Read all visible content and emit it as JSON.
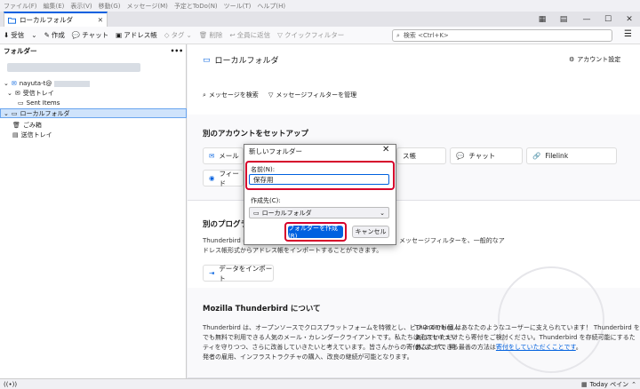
{
  "menubar": [
    "ファイル(F)",
    "編集(E)",
    "表示(V)",
    "移動(G)",
    "メッセージ(M)",
    "予定とToDo(N)",
    "ツール(T)",
    "ヘルプ(H)"
  ],
  "tab": {
    "label": "ローカルフォルダ"
  },
  "toolbar": {
    "get_mail": "受信",
    "write": "作成",
    "chat": "チャット",
    "address_book": "アドレス帳",
    "tag": "タグ",
    "delete": "削除",
    "reply_all": "全員に返信",
    "quick_filter": "クイックフィルター"
  },
  "search": {
    "placeholder": "検索 <Ctrl+K>"
  },
  "folder_pane": {
    "header": "フォルダー",
    "more": "•••",
    "account": "nayuta-t@",
    "inbox": "受信トレイ",
    "sent": "Sent Items",
    "local": "ローカルフォルダ",
    "trash": "ごみ箱",
    "outbox": "送信トレイ"
  },
  "main": {
    "title": "ローカルフォルダ",
    "account_settings": "アカウント設定",
    "search_messages": "メッセージを検索",
    "manage_filters": "メッセージフィルターを管理",
    "setup_heading": "別のアカウントをセットアップ",
    "cards": {
      "mail": "メール",
      "address": "ス帳",
      "chat": "チャット",
      "filelink": "Filelink",
      "feed": "フィード"
    },
    "import_heading": "別のプログラム",
    "import_text_1": "Thunderbird に",
    "import_text_1b": "メッセージフィルターを、一般的なア",
    "import_text_2": "ドレス帳形式からアドレス帳をインポートすることができます。",
    "import_button": "データをインポート",
    "about_heading": "Mozilla Thunderbird について",
    "about_text_1": "Thunderbird は、オープンソースでクロスプラットフォームを特徴とし、ビジネスでも個人",
    "about_text_2": "でも無料で利用できる人気のメール・カレンダークライアントです。私たちはそのセキュリ",
    "about_text_3": "ティを守りつつ、さらに改善していきたいと考えています。皆さんからの寄付によって、開",
    "about_text_4": "発者の雇用、インフラストラクチャの購入、改良の継続が可能となります。",
    "donate_text_1": "Thunderbird はあなたのようなユーザーに支えられています！ Thunderbird を気に",
    "donate_text_2": "入っていただけたら寄付をご検討ください。Thunderbird を存続可能にするため、",
    "donate_text_3": "あなたができる最善の方法は",
    "donate_link": "寄付をしていただくことです",
    "donate_text_4": "。"
  },
  "dialog": {
    "title": "新しいフォルダー",
    "name_label": "名前(N):",
    "name_value": "保存用",
    "create_in_label": "作成先(C):",
    "create_in_value": "ローカルフォルダ",
    "create_button": "フォルダーを作成(R)",
    "cancel_button": "キャンセル"
  },
  "status": {
    "today_pane": "Today ペイン"
  },
  "colors": {
    "accent": "#0060df",
    "highlight": "#d6002b",
    "selection": "#cfe3fb"
  }
}
